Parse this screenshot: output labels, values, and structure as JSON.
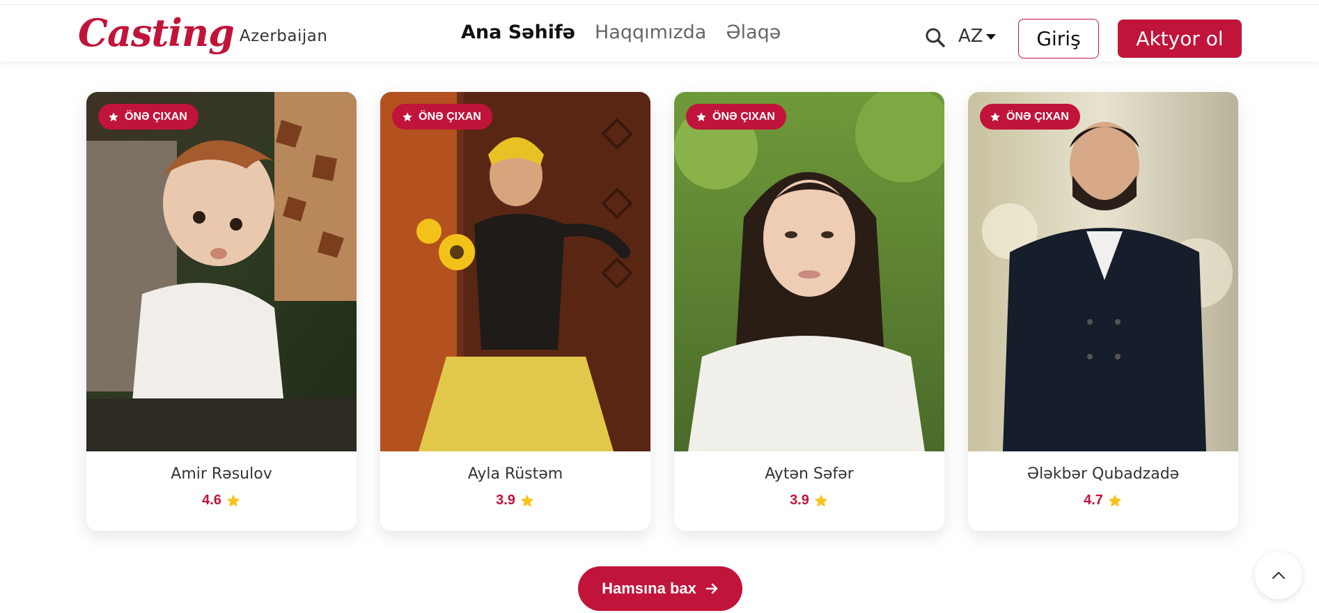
{
  "brand": {
    "script": "Casting",
    "sub": "Azerbaijan",
    "color": "#c1143a"
  },
  "nav": {
    "items": [
      {
        "label": "Ana Səhifə",
        "active": true
      },
      {
        "label": "Haqqımızda",
        "active": false
      },
      {
        "label": "Əlaqə",
        "active": false
      }
    ]
  },
  "header": {
    "search_icon": "search-icon",
    "language": "AZ",
    "login_label": "Giriş",
    "actor_label": "Aktyor ol"
  },
  "badge_label": "ÖNƏ ÇIXAN",
  "cards": [
    {
      "name": "Amir Rəsulov",
      "rating": "4.6"
    },
    {
      "name": "Ayla Rüstəm",
      "rating": "3.9"
    },
    {
      "name": "Aytən Səfər",
      "rating": "3.9"
    },
    {
      "name": "Ələkbər Qubadzadə",
      "rating": "4.7"
    }
  ],
  "see_all_label": "Hamsına bax",
  "colors": {
    "accent": "#c1143a",
    "star": "#f5c518"
  }
}
